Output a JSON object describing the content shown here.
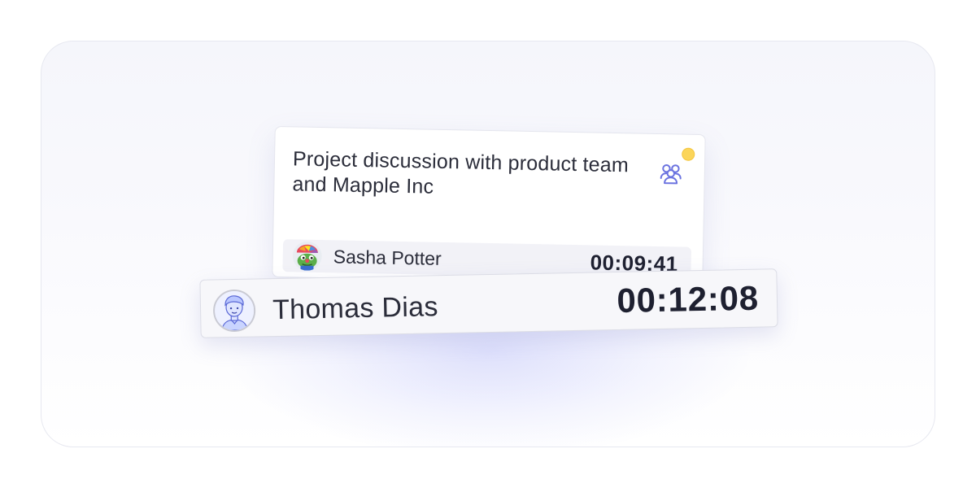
{
  "meeting": {
    "title": "Project discussion with product team and Mapple Inc",
    "status_color": "#fbd55a",
    "icon": "people-group-icon",
    "participant": {
      "name": "Sasha Potter",
      "time": "00:09:41",
      "avatar": "frog-avatar"
    }
  },
  "active_participant": {
    "name": "Thomas Dias",
    "time": "00:12:08",
    "avatar": "cartoon-man-avatar"
  },
  "colors": {
    "accent": "#6b73e0",
    "status": "#fbd55a"
  }
}
